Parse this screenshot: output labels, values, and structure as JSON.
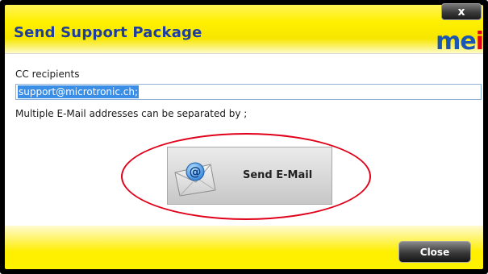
{
  "window": {
    "title": "Send Support Package",
    "close_glyph": "x",
    "logo_text_before": "m",
    "logo_text_e": "e",
    "logo_text_after": "i"
  },
  "form": {
    "cc_label": "CC recipients",
    "cc_value": "support@microtronic.ch;",
    "hint": "Multiple E-Mail addresses can be separated by ;"
  },
  "send_button": {
    "label": "Send E-Mail",
    "icon": "email-envelope-icon"
  },
  "footer": {
    "close_label": "Close"
  },
  "colors": {
    "title": "#1d3ea0",
    "banner_yellow": "#fff000",
    "highlight": "#e1001a",
    "selection": "#3a8ee6"
  }
}
